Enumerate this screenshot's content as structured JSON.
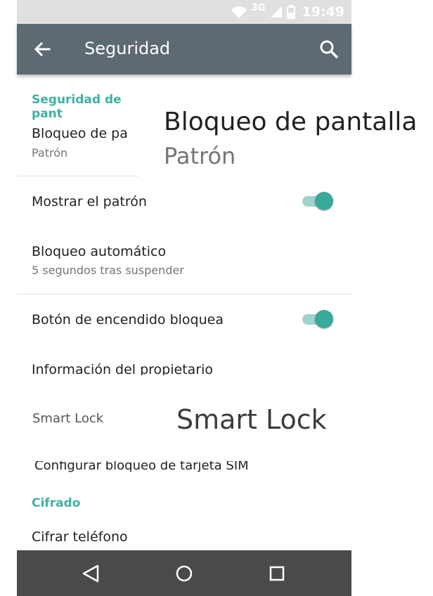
{
  "status_bar": {
    "network": "3G",
    "time": "19:49"
  },
  "app_bar": {
    "title": "Seguridad"
  },
  "sections": {
    "screen_security": "Seguridad de pant",
    "encryption": "Cifrado"
  },
  "items": {
    "screen_lock": {
      "title": "Bloqueo de pa",
      "subtitle": "Patrón"
    },
    "show_pattern": {
      "title": "Mostrar el patrón",
      "enabled": true
    },
    "auto_lock": {
      "title": "Bloqueo automático",
      "subtitle": "5 segundos tras suspender"
    },
    "power_button_locks": {
      "title": "Botón de encendido bloquea",
      "enabled": true
    },
    "owner_info": {
      "title": "Información del propietario"
    },
    "smart_lock": {
      "title": "Smart Lock"
    },
    "sim_lock": {
      "title": "Configurar bloqueo de tarjeta SIM"
    },
    "encrypt_phone": {
      "title": "Cifrar teléfono"
    }
  },
  "overlay": {
    "screen_lock_title": "Bloqueo de pantalla",
    "screen_lock_subtitle": "Patrón",
    "smart_lock": "Smart Lock"
  },
  "colors": {
    "accent": "#3fb2a2",
    "app_bar": "#5e6a71",
    "nav_bar": "#4a4a4a"
  },
  "icons": {
    "back": "arrow-left-icon",
    "search": "search-icon",
    "nav_back": "triangle-back-icon",
    "nav_home": "circle-home-icon",
    "nav_recents": "square-recents-icon"
  }
}
